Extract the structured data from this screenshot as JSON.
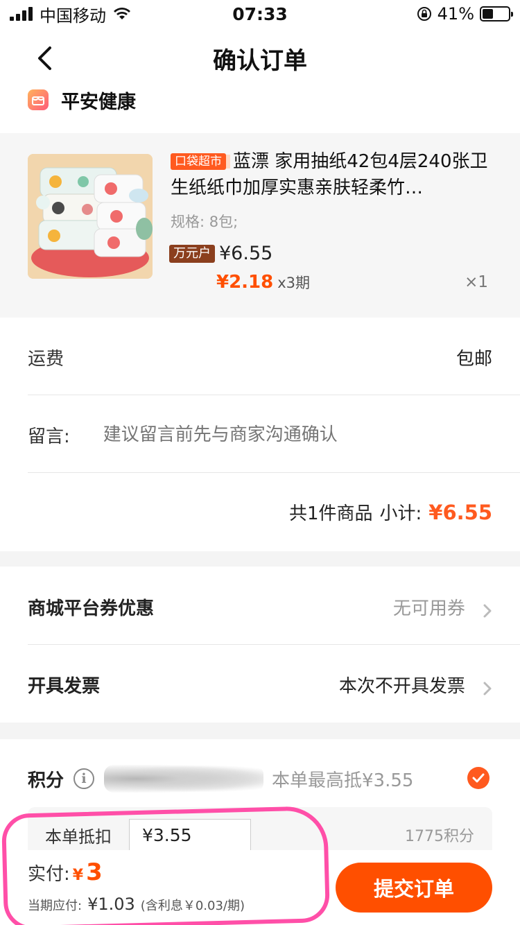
{
  "status_bar": {
    "carrier": "中国移动",
    "time": "07:33",
    "battery": "41%",
    "battery_level": 0.41
  },
  "nav": {
    "title": "确认订单"
  },
  "store": {
    "name": "平安健康"
  },
  "product": {
    "tag": "口袋超市",
    "title": "蓝漂 家用抽纸42包4层240张卫生纸纸巾加厚实惠亲肤轻柔竹…",
    "spec": "规格: 8包;",
    "price_tag": "万元户",
    "price": "¥6.55",
    "installment_price": "¥2.18",
    "installment_periods": "x3期",
    "qty": "×1"
  },
  "shipping": {
    "label": "运费",
    "value": "包邮"
  },
  "message": {
    "label": "留言:",
    "placeholder": "建议留言前先与商家沟通确认"
  },
  "subtotal": {
    "count_text": "共1件商品",
    "label": "小计:",
    "amount": "¥6.55"
  },
  "coupon": {
    "label": "商城平台券优惠",
    "value": "无可用券"
  },
  "invoice": {
    "label": "开具发票",
    "value": "本次不开具发票"
  },
  "points": {
    "label": "积分",
    "max_text": "本单最高抵¥3.55",
    "deduct_label": "本单抵扣",
    "deduct_value": "¥3.55",
    "points_used": "1775积分"
  },
  "footer": {
    "pay_label": "实付:",
    "currency": "¥",
    "pay_amount": "3",
    "period_label": "当期应付:",
    "period_amount": "¥1.03",
    "period_note": "(含利息￥0.03/期)",
    "submit": "提交订单"
  },
  "colors": {
    "accent": "#ff4f00",
    "highlight": "#ff4fa8",
    "gray_bg": "#f4f4f4"
  }
}
